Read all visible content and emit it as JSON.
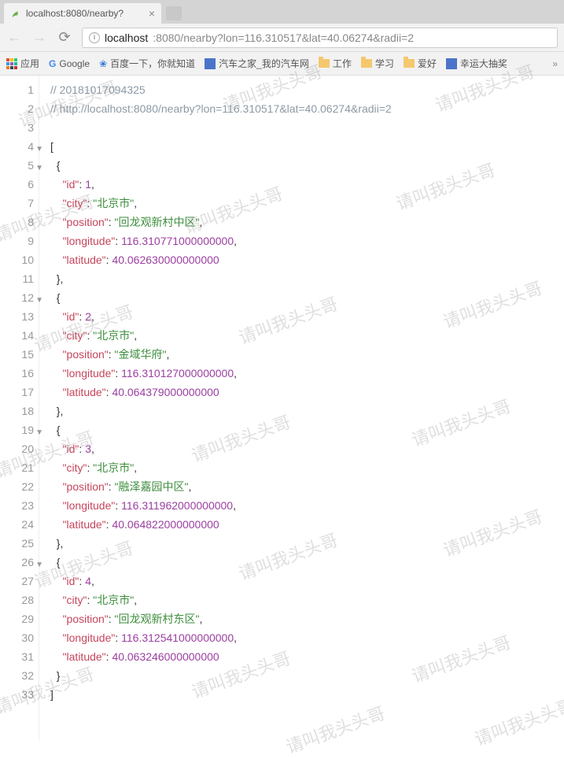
{
  "tab": {
    "title": "localhost:8080/nearby?",
    "close": "×"
  },
  "url": {
    "info": "i",
    "host": "localhost",
    "path": ":8080/nearby?lon=116.310517&lat=40.06274&radii=2"
  },
  "bookmarks": {
    "apps": "应用",
    "google": "Google",
    "baidu": "百度一下，你就知道",
    "autohome": "汽车之家_我的汽车网",
    "work": "工作",
    "study": "学习",
    "hobby": "爱好",
    "lottery": "幸运大抽奖",
    "more": "»"
  },
  "watermark": "请叫我头头哥",
  "code": {
    "comment1": "// 20181017094325",
    "comment2": "// http://localhost:8080/nearby?lon=116.310517&lat=40.06274&radii=2",
    "open_bracket": "[",
    "close_bracket": "]",
    "open_brace": "{",
    "close_brace": "}",
    "close_brace_comma": "},",
    "colon": ":",
    "comma": ",",
    "quote": "\"",
    "keys": {
      "id": "id",
      "city": "city",
      "position": "position",
      "longitude": "longitude",
      "latitude": "latitude"
    },
    "items": [
      {
        "id": "1",
        "city": "北京市",
        "position": "回龙观新村中区",
        "longitude": "116.310771000000000",
        "latitude": "40.062630000000000"
      },
      {
        "id": "2",
        "city": "北京市",
        "position": "金域华府",
        "longitude": "116.310127000000000",
        "latitude": "40.064379000000000"
      },
      {
        "id": "3",
        "city": "北京市",
        "position": "融泽嘉园中区",
        "longitude": "116.311962000000000",
        "latitude": "40.064822000000000"
      },
      {
        "id": "4",
        "city": "北京市",
        "position": "回龙观新村东区",
        "longitude": "116.312541000000000",
        "latitude": "40.063246000000000"
      }
    ]
  },
  "lines": [
    "1",
    "2",
    "3",
    "4",
    "5",
    "6",
    "7",
    "8",
    "9",
    "10",
    "11",
    "12",
    "13",
    "14",
    "15",
    "16",
    "17",
    "18",
    "19",
    "20",
    "21",
    "22",
    "23",
    "24",
    "25",
    "26",
    "27",
    "28",
    "29",
    "30",
    "31",
    "32",
    "33"
  ],
  "fold_lines": [
    4,
    5,
    12,
    19,
    26
  ]
}
